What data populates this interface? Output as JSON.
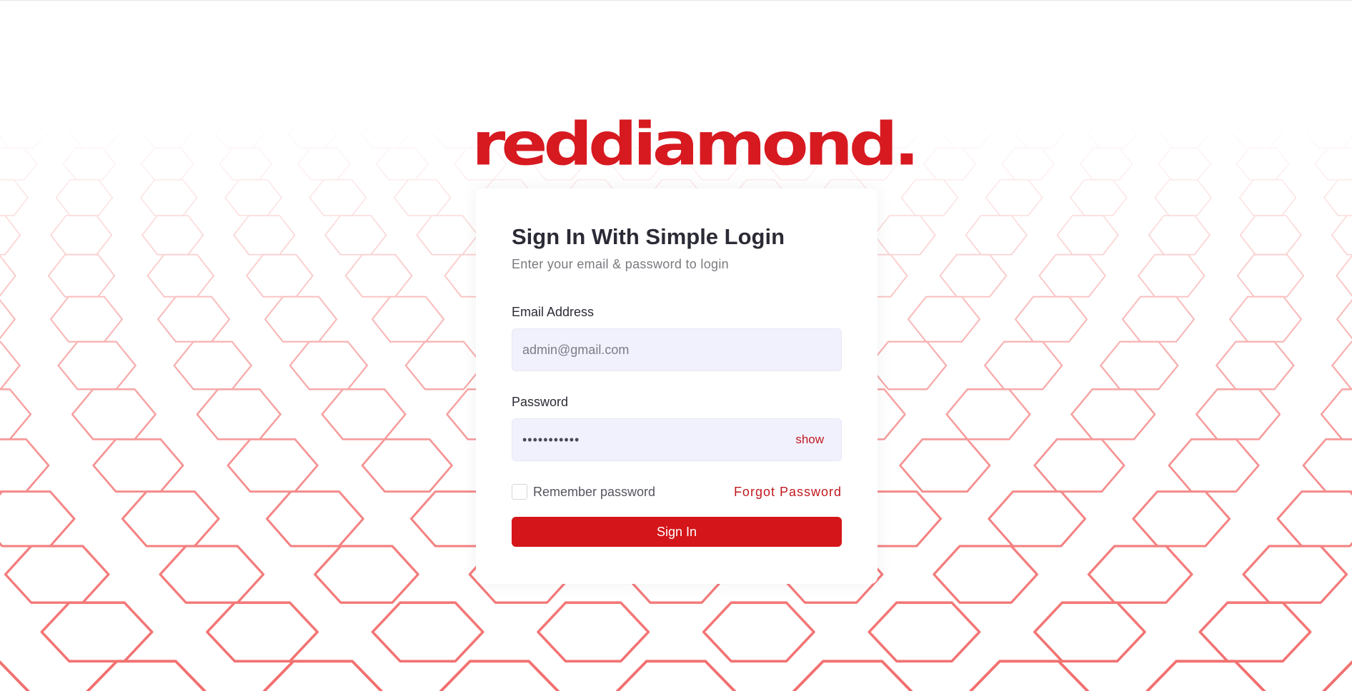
{
  "brand": {
    "logo_text": "reddiamond.",
    "color": "#d71920"
  },
  "login": {
    "title": "Sign In With Simple Login",
    "subtitle": "Enter your email & password to login",
    "email_label": "Email Address",
    "email_placeholder": "admin@gmail.com",
    "password_label": "Password",
    "password_value": "•••••••••••",
    "show_label": "show",
    "remember_label": "Remember password",
    "remember_checked": false,
    "forgot_label": "Forgot Password",
    "signin_label": "Sign In"
  },
  "colors": {
    "accent": "#d4151a",
    "input_bg": "#f1f1fd",
    "pattern_stroke": "#f26d6d"
  },
  "background": {
    "pattern": "red-hexagon-mesh"
  }
}
